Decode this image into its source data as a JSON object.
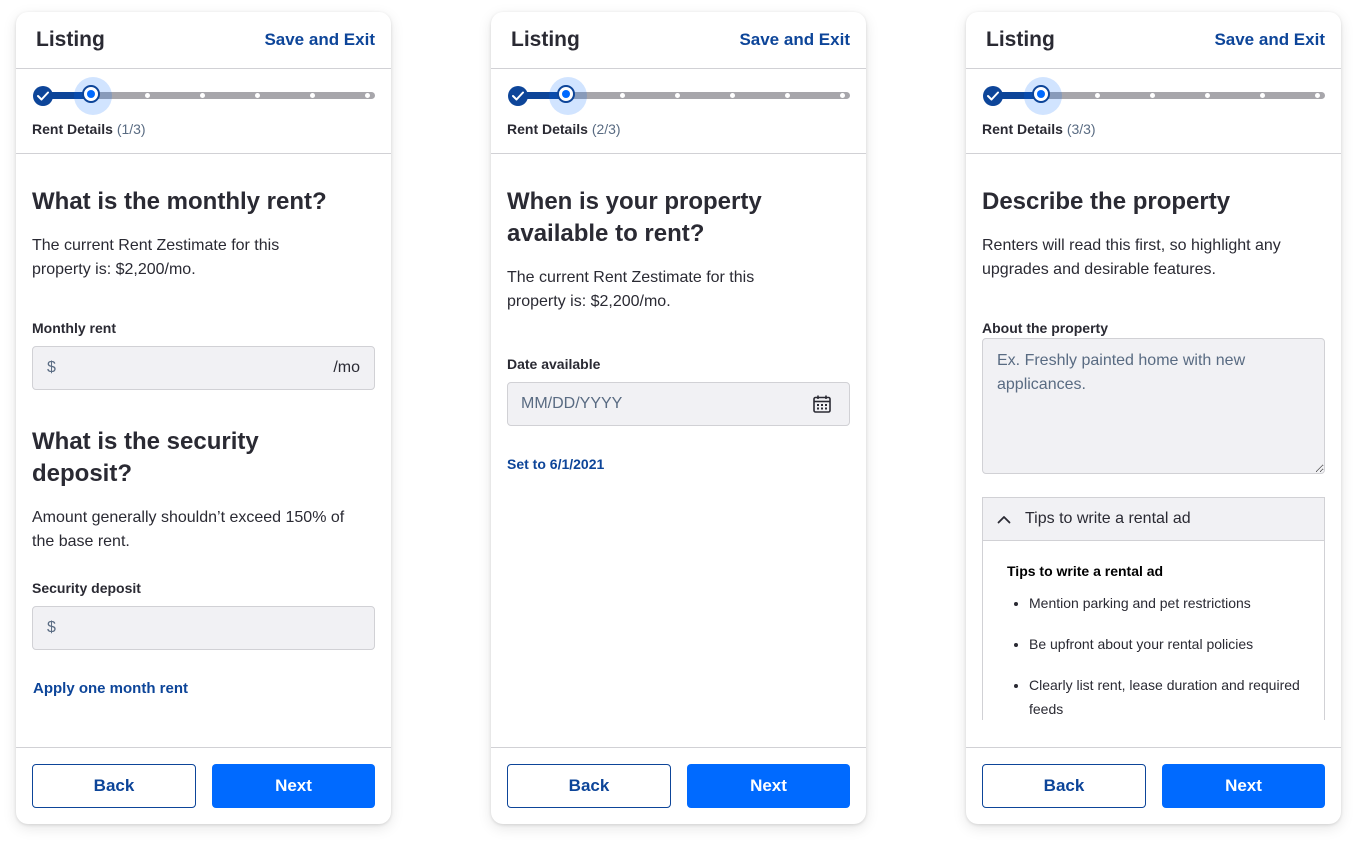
{
  "header": {
    "title": "Listing",
    "save_exit": "Save and Exit"
  },
  "colors": {
    "brand_dark": "#0d4599",
    "primary": "#006aff",
    "track": "#a7a6ab",
    "field_bg": "#f1f1f4"
  },
  "screens": [
    {
      "step_label": "Rent Details",
      "step_count": "(1/3)",
      "rent_heading": "What is the monthly rent?",
      "rent_desc": "The current Rent Zestimate for this property is: $2,200/mo.",
      "rent_label": "Monthly rent",
      "rent_prefix": "$",
      "rent_suffix": "/mo",
      "deposit_heading": "What is the security deposit?",
      "deposit_desc": "Amount generally shouldn’t exceed 150% of the base rent.",
      "deposit_label": "Security deposit",
      "deposit_prefix": "$",
      "apply_link": "Apply one month rent"
    },
    {
      "step_label": "Rent Details",
      "step_count": "(2/3)",
      "heading": "When is your property available to rent?",
      "desc": "The current Rent Zestimate for this property is: $2,200/mo.",
      "date_label": "Date available",
      "date_placeholder": "MM/DD/YYYY",
      "set_link": "Set to 6/1/2021"
    },
    {
      "step_label": "Rent Details",
      "step_count": "(3/3)",
      "heading": "Describe the property",
      "desc": "Renters will read this first, so highlight any upgrades and desirable features.",
      "about_label": "About the property",
      "about_placeholder": "Ex. Freshly painted home with new applicances.",
      "accordion_label": "Tips to write a rental ad",
      "tips_title": "Tips to write a rental ad",
      "tips": [
        "Mention parking and pet restrictions",
        "Be upfront about your rental policies",
        "Clearly list rent, lease duration and required feeds"
      ]
    }
  ],
  "footer": {
    "back": "Back",
    "next": "Next"
  },
  "icons": {
    "check": "check-icon",
    "calendar": "calendar-icon",
    "chevron": "chevron-up-icon"
  }
}
